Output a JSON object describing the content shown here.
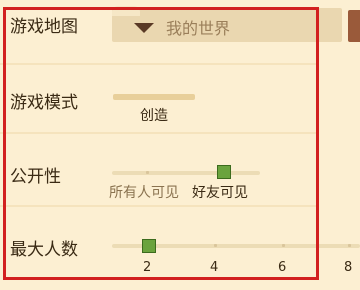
{
  "rows": {
    "game_map": {
      "label": "游戏地图",
      "value": "我的世界"
    },
    "game_mode": {
      "label": "游戏模式",
      "value": "创造"
    },
    "visibility": {
      "label": "公开性",
      "options": [
        "所有人可见",
        "好友可见"
      ],
      "selected_index": 1
    },
    "max_players": {
      "label": "最大人数",
      "ticks": [
        "2",
        "4",
        "6",
        "8"
      ],
      "value": 2
    }
  },
  "icons": {
    "dropdown": "chevron-down-icon"
  },
  "colors": {
    "accent": "#d2201f",
    "thumb": "#6aa33d",
    "background": "#fcefd2"
  }
}
